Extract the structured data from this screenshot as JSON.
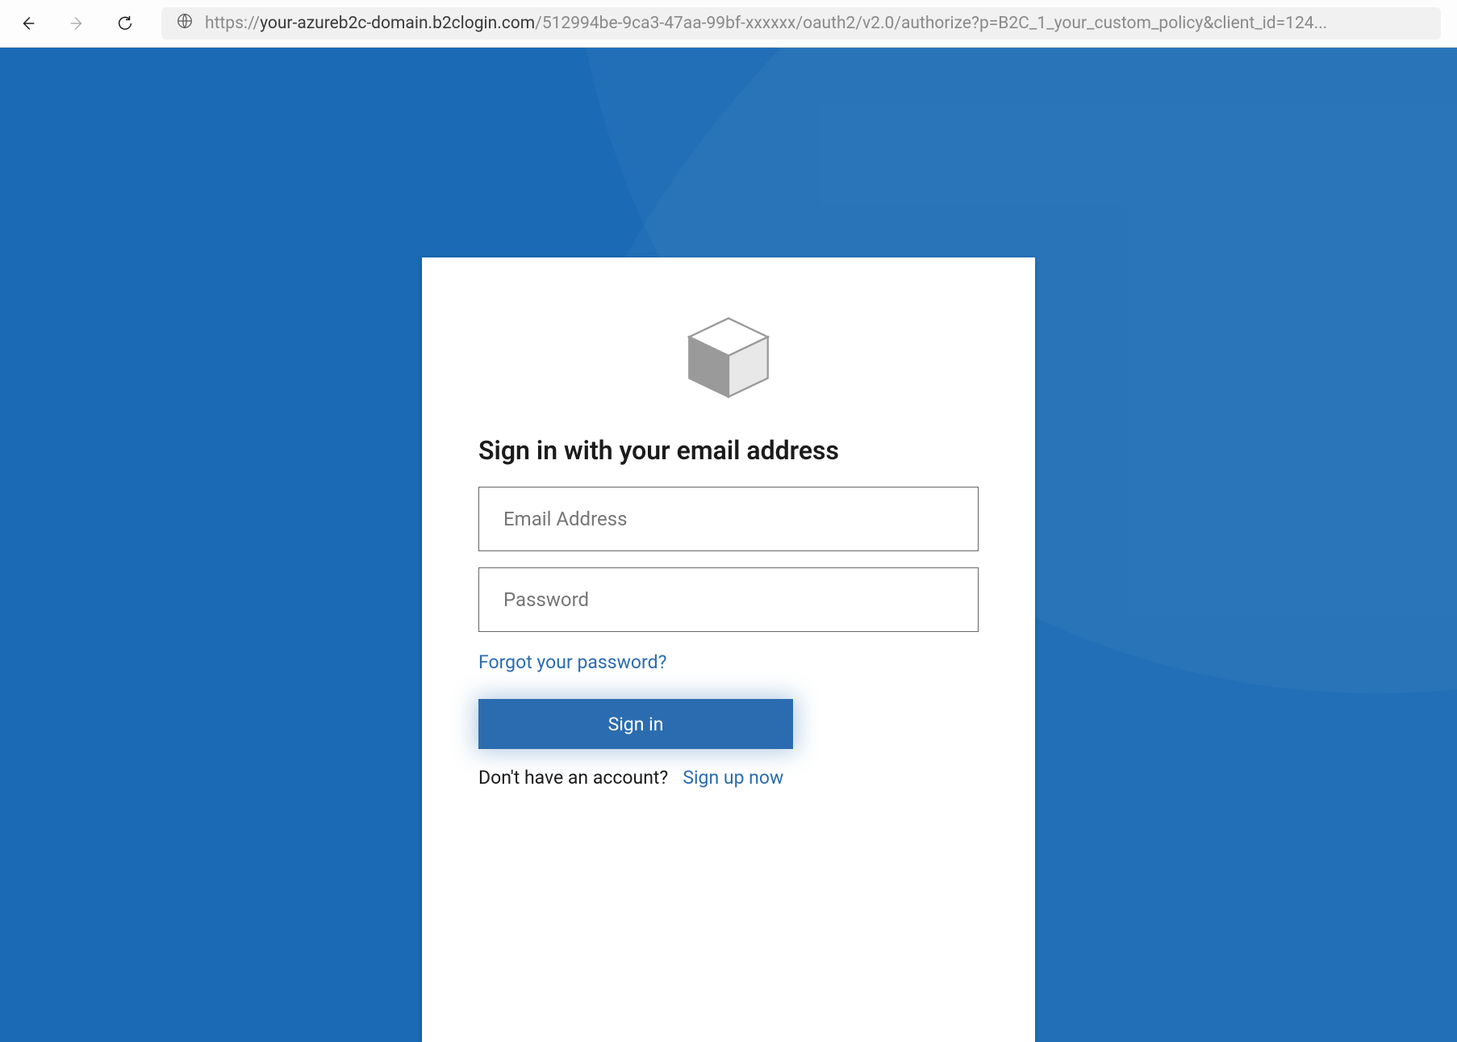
{
  "browser": {
    "url_scheme": "https://",
    "url_host": "your-azureb2c-domain.b2clogin.com",
    "url_path": "/512994be-9ca3-47aa-99bf-xxxxxx/oauth2/v2.0/authorize?p=B2C_1_your_custom_policy&client_id=124..."
  },
  "signin": {
    "heading": "Sign in with your email address",
    "email_placeholder": "Email Address",
    "password_placeholder": "Password",
    "forgot_label": "Forgot your password?",
    "submit_label": "Sign in",
    "no_account_label": "Don't have an account?",
    "signup_label": "Sign up now"
  }
}
